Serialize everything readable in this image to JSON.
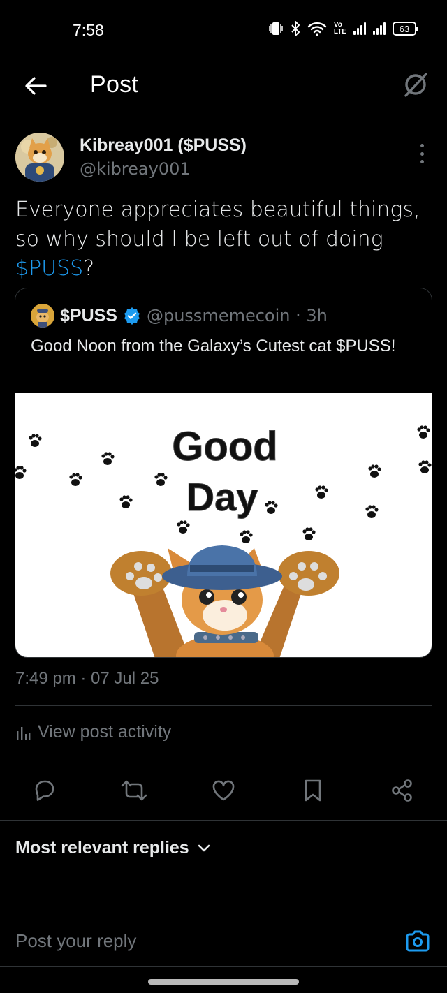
{
  "status_bar": {
    "time": "7:58",
    "volte_label": "Vo\nLTE",
    "battery": "63"
  },
  "header": {
    "title": "Post",
    "back_icon": "arrow-left-icon",
    "grok_icon": "grok-icon"
  },
  "post": {
    "author_name": "Kibreay001 ($PUSS)",
    "author_handle": "@kibreay001",
    "text_before": "Everyone appreciates beautiful things, so why should I be left out of doing ",
    "cashtag": "$PUSS",
    "text_after": "?",
    "timestamp": "7:49 pm · 07 Jul 25"
  },
  "quote": {
    "name": "$PUSS",
    "handle_time": "@pussmemecoin · 3h",
    "text": "Good Noon from the Galaxy’s Cutest cat $PUSS!",
    "image_text_line1": "Good",
    "image_text_line2": "Day"
  },
  "activity": {
    "label": "View post activity"
  },
  "actions": [
    "reply-icon",
    "repost-icon",
    "like-icon",
    "bookmark-icon",
    "share-icon"
  ],
  "replies": {
    "sort_label": "Most relevant replies"
  },
  "reply_input": {
    "placeholder": "Post your reply"
  },
  "colors": {
    "background": "#000000",
    "text": "#e7e9ea",
    "muted": "#71767b",
    "accent": "#1d9bf0",
    "divider": "#2f3336"
  }
}
